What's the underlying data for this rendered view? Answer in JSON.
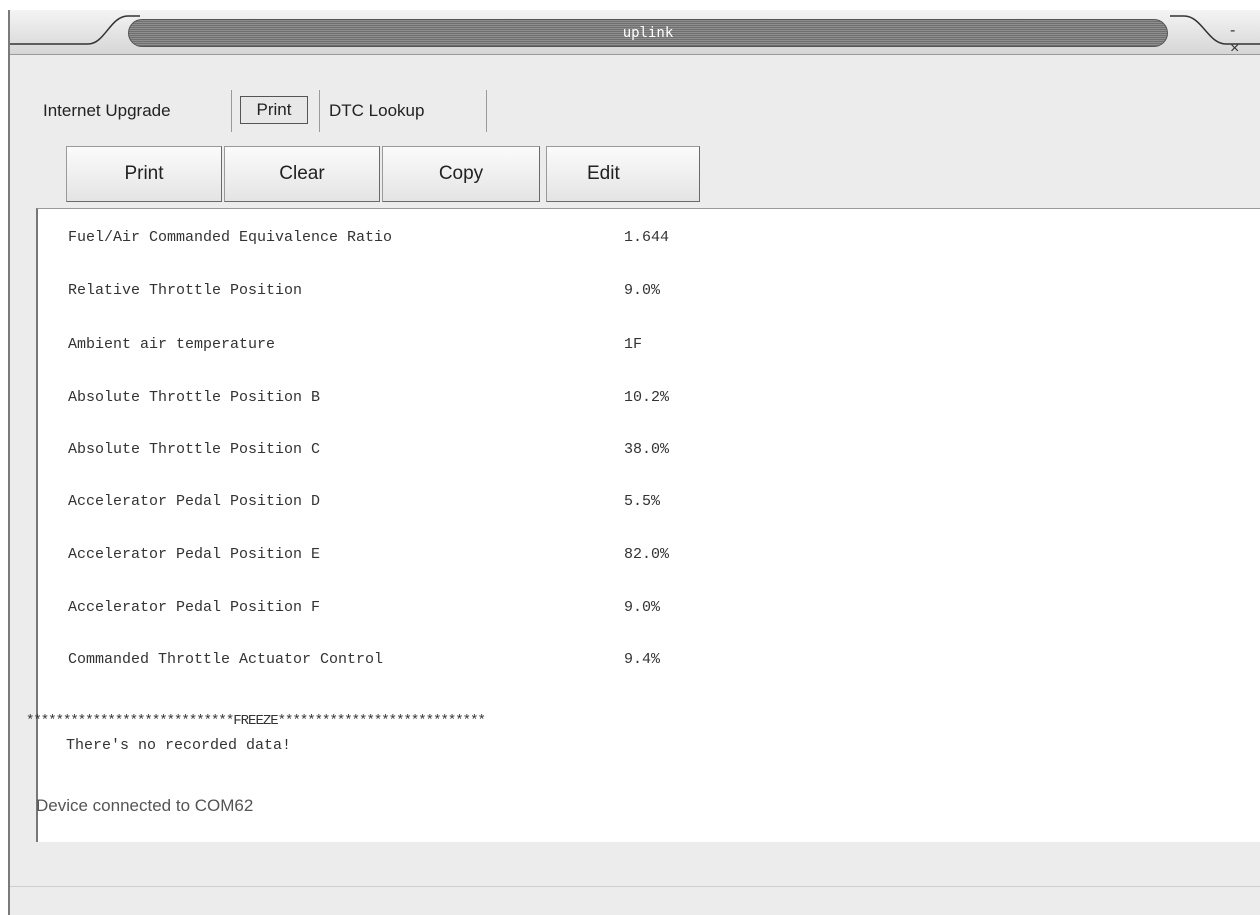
{
  "window": {
    "title": "uplink",
    "controls": "- ×"
  },
  "tabs": [
    {
      "label": "Internet Upgrade"
    },
    {
      "label": "Print"
    },
    {
      "label": "DTC Lookup"
    }
  ],
  "toolbar": {
    "print_label": "Print",
    "clear_label": "Clear",
    "copy_label": "Copy",
    "edit_label": "Edit"
  },
  "readings": [
    {
      "label": "Fuel/Air Commanded Equivalence Ratio",
      "value": "1.644"
    },
    {
      "label": "Relative Throttle Position",
      "value": "9.0%"
    },
    {
      "label": "Ambient air temperature",
      "value": "1F"
    },
    {
      "label": "Absolute Throttle Position B",
      "value": "10.2%"
    },
    {
      "label": "Absolute Throttle Position C",
      "value": "38.0%"
    },
    {
      "label": "Accelerator Pedal Position D",
      "value": "5.5%"
    },
    {
      "label": "Accelerator Pedal Position E",
      "value": "82.0%"
    },
    {
      "label": "Accelerator Pedal Position F",
      "value": "9.0%"
    },
    {
      "label": "Commanded Throttle Actuator Control",
      "value": "9.4%"
    }
  ],
  "freeze": {
    "separator": "****************************FREEZE****************************",
    "message": "There's no recorded data!"
  },
  "status": {
    "text": "Device connected to COM62"
  }
}
